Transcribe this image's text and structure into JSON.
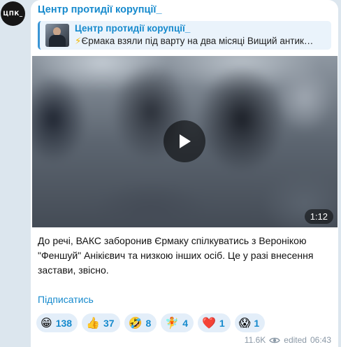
{
  "channel": {
    "avatar_text": "ЦПК_",
    "name": "Центр протидії корупції_"
  },
  "reply": {
    "title": "Центр протидії корупції_",
    "bolt": "⚡",
    "text": "Єрмака взяли під варту на два місяці Вищий антик…"
  },
  "video": {
    "duration": "1:12"
  },
  "message": {
    "text": "До речі, ВАКС заборонив Єрмаку спілкуватись з Веронікою \"Феншуй\" Анікієвич та низкою інших осіб. Це у разі внесення застави, звісно."
  },
  "subscribe_label": "Підписатись",
  "reactions": [
    {
      "icon": "grinning-face",
      "emoji": "😁",
      "count": "138"
    },
    {
      "icon": "thumbs-up",
      "emoji": "👍",
      "count": "37"
    },
    {
      "icon": "rofl",
      "emoji": "🤣",
      "count": "8"
    },
    {
      "icon": "tooth-fairy",
      "emoji": "🧚",
      "count": "4"
    },
    {
      "icon": "red-heart",
      "emoji": "❤️",
      "count": "1"
    },
    {
      "icon": "screaming-face",
      "emoji": "😱",
      "count": "1"
    }
  ],
  "meta": {
    "views": "11.6K",
    "edited_label": "edited",
    "time": "06:43"
  },
  "colors": {
    "accent": "#168acd",
    "reaction_bg": "#e3eef9",
    "reply_bg": "#eaf3fb",
    "chat_bg": "#dce6ee"
  }
}
